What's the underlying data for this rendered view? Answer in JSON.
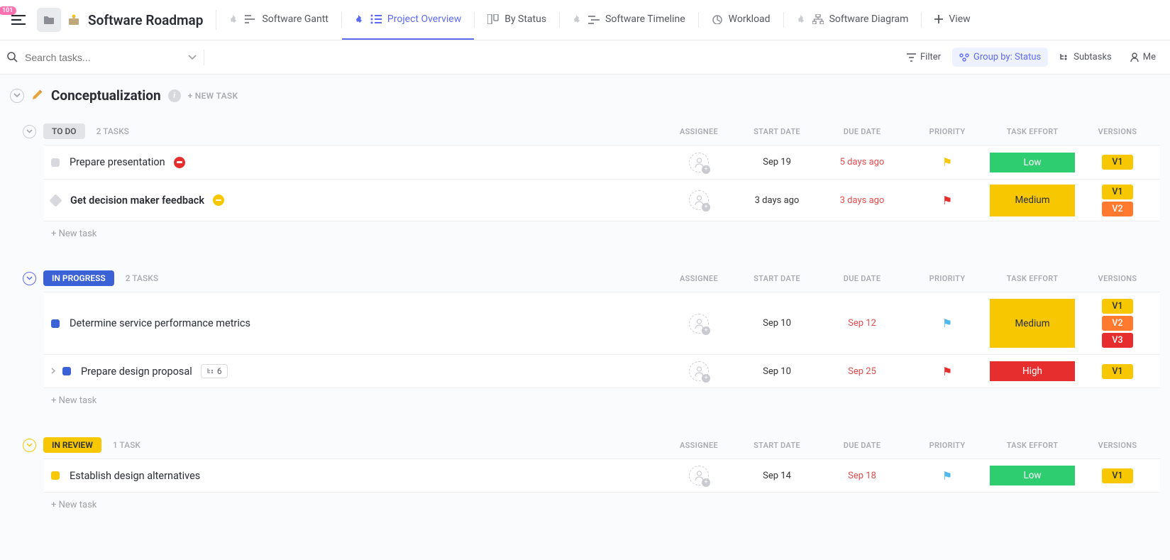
{
  "header": {
    "notif_count": "101",
    "title": "Software Roadmap",
    "tabs": [
      {
        "label": "Software Gantt"
      },
      {
        "label": "Project Overview"
      },
      {
        "label": "By Status"
      },
      {
        "label": "Software Timeline"
      },
      {
        "label": "Workload"
      },
      {
        "label": "Software Diagram"
      },
      {
        "label": "View"
      }
    ]
  },
  "toolbar": {
    "search_placeholder": "Search tasks...",
    "filter": "Filter",
    "group_by": "Group by: Status",
    "subtasks": "Subtasks",
    "me": "Me"
  },
  "section": {
    "title": "Conceptualization",
    "new_task": "+ NEW TASK"
  },
  "columns": {
    "assignee": "ASSIGNEE",
    "start": "START DATE",
    "due": "DUE DATE",
    "priority": "PRIORITY",
    "effort": "TASK EFFORT",
    "versions": "VERSIONS"
  },
  "groups": [
    {
      "status": "TO DO",
      "count": "2 TASKS",
      "tasks": [
        {
          "name": "Prepare presentation",
          "start": "Sep 19",
          "due": "5 days ago",
          "effort": "Low",
          "versions": [
            "V1"
          ]
        },
        {
          "name": "Get decision maker feedback",
          "start": "3 days ago",
          "due": "3 days ago",
          "effort": "Medium",
          "versions": [
            "V1",
            "V2"
          ]
        }
      ]
    },
    {
      "status": "IN PROGRESS",
      "count": "2 TASKS",
      "tasks": [
        {
          "name": "Determine service performance metrics",
          "start": "Sep 10",
          "due": "Sep 12",
          "effort": "Medium",
          "versions": [
            "V1",
            "V2",
            "V3"
          ]
        },
        {
          "name": "Prepare design proposal",
          "subtasks": "6",
          "start": "Sep 10",
          "due": "Sep 25",
          "effort": "High",
          "versions": [
            "V1"
          ]
        }
      ]
    },
    {
      "status": "IN REVIEW",
      "count": "1 TASK",
      "tasks": [
        {
          "name": "Establish design alternatives",
          "start": "Sep 14",
          "due": "Sep 18",
          "effort": "Low",
          "versions": [
            "V1"
          ]
        }
      ]
    }
  ],
  "new_task_row": "+ New task"
}
